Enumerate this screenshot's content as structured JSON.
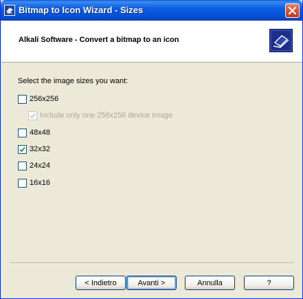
{
  "window": {
    "title": "Bitmap to Icon Wizard - Sizes",
    "icon": "wizard-app-icon"
  },
  "header": {
    "title": "Alkali Software - Convert a bitmap to an icon",
    "logo_icon": "wizard-logo-icon"
  },
  "main": {
    "prompt": "Select the image sizes you want:",
    "options": [
      {
        "label": "256x256",
        "checked": false,
        "enabled": true
      },
      {
        "label": "Include only one 256x256 device image",
        "checked": true,
        "enabled": false
      },
      {
        "label": "48x48",
        "checked": false,
        "enabled": true
      },
      {
        "label": "32x32",
        "checked": true,
        "enabled": true
      },
      {
        "label": "24x24",
        "checked": false,
        "enabled": true
      },
      {
        "label": "16x16",
        "checked": false,
        "enabled": true
      }
    ]
  },
  "buttons": {
    "back": "< Indietro",
    "next": "Avanti >",
    "cancel": "Annulla",
    "help": "?"
  },
  "colors": {
    "titlebar": "#0b5ee3",
    "face": "#ece9d8",
    "check": "#21a121",
    "close": "#d64a2c"
  }
}
